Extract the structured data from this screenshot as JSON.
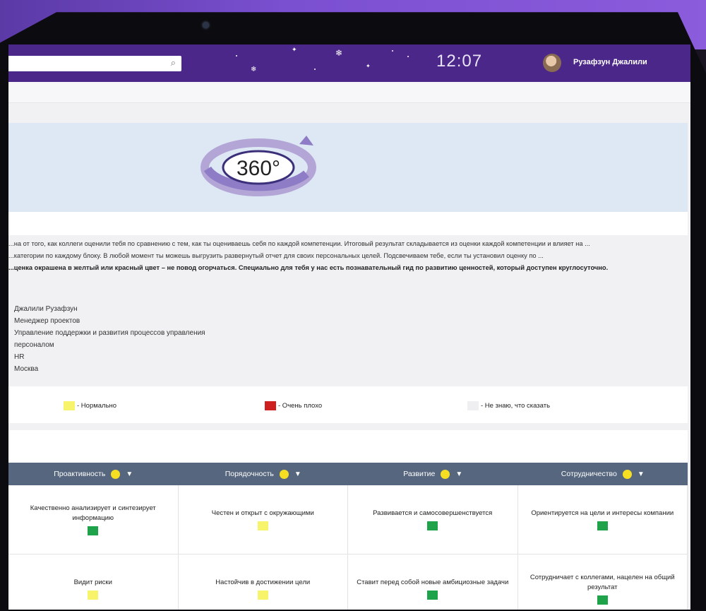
{
  "topbar": {
    "clock": "12:07",
    "user_name": "Рузафзун Джалили"
  },
  "hero": {
    "logo_text": "360°"
  },
  "description": {
    "line1": "...на от того, как коллеги оценили тебя по сравнению с тем, как ты оцениваешь себя по каждой компетенции. Итоговый результат складывается из оценки каждой компетенции и влияет на ...",
    "line2": "...категории по каждому блоку. В любой момент ты можешь выгрузить развернутый отчет для своих персональных целей. Подсвечиваем тебе, если ты установил оценку по ...",
    "line3": "...ценка окрашена в желтый или красный цвет – не повод огорчаться. Специально для тебя у нас есть познавательный гид по развитию ценностей, который доступен круглосуточно."
  },
  "employee": {
    "name": "Джалили Рузафзун",
    "position": "Менеджер проектов",
    "department_line1": "Управление поддержки и развития процессов управления",
    "department_line2": "персоналом",
    "unit": "HR",
    "city": "Москва"
  },
  "legend": [
    {
      "label": "- Нормально",
      "color": "#f7f36a"
    },
    {
      "label": "- Очень плохо",
      "color": "#cf2020"
    },
    {
      "label": "- Не знаю, что сказать",
      "color": "#efeff1"
    }
  ],
  "table": {
    "columns": [
      "Проактивность",
      "Порядочность",
      "Развитие",
      "Сотрудничество"
    ],
    "rows": [
      [
        {
          "text": "Качественно анализирует и синтезирует информацию",
          "color": "#1ea34a"
        },
        {
          "text": "Честен и открыт с окружающими",
          "color": "#f7f36a"
        },
        {
          "text": "Развивается и самосовершенствуется",
          "color": "#1ea34a"
        },
        {
          "text": "Ориентируется на цели и интересы компании",
          "color": "#1ea34a"
        }
      ],
      [
        {
          "text": "Видит риски",
          "color": "#f7f36a"
        },
        {
          "text": "Настойчив в достижении цели",
          "color": "#f7f36a"
        },
        {
          "text": "Ставит перед собой новые амбициозные задачи",
          "color": "#1ea34a"
        },
        {
          "text": "Сотрудничает с коллегами, нацелен на общий результат",
          "color": "#1ea34a"
        }
      ]
    ]
  },
  "colors": {
    "topbar": "#4b2789",
    "table_header": "#56667e",
    "hero_background": "#dde8f4"
  }
}
